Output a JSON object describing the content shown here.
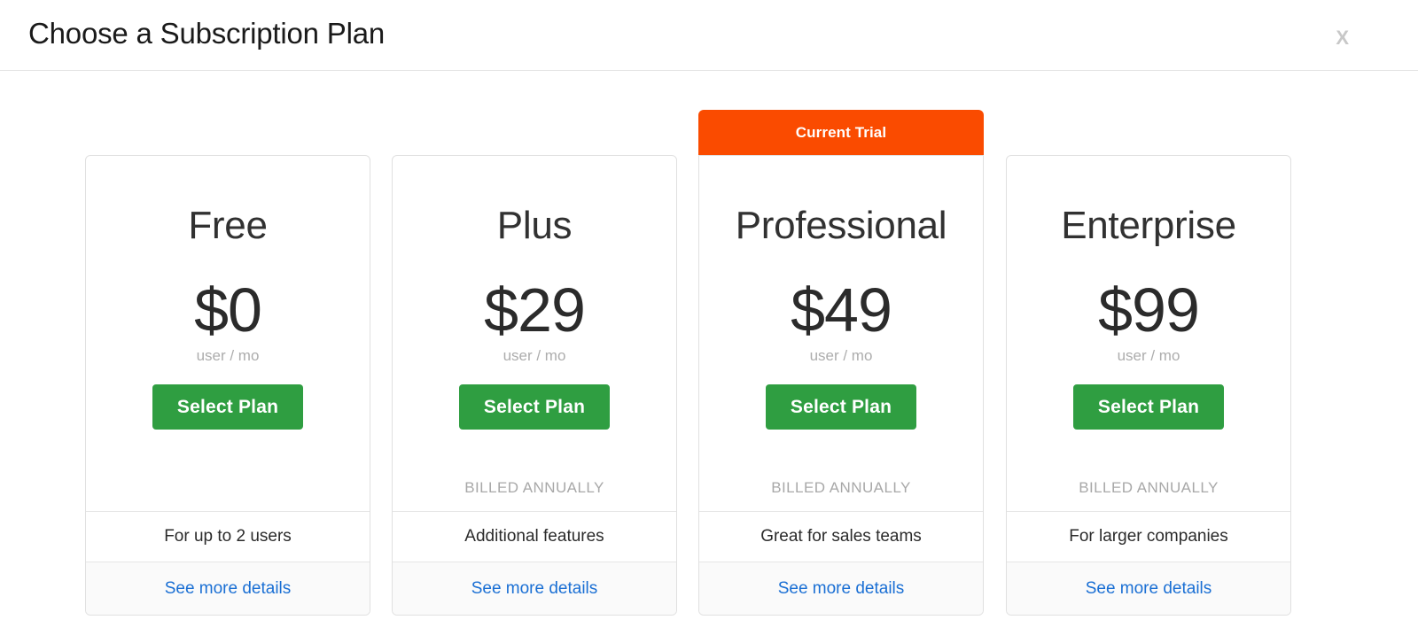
{
  "header": {
    "title": "Choose a Subscription Plan",
    "close_label": "X",
    "close_icon": "close-icon"
  },
  "colors": {
    "badge_orange": "#fa4b00",
    "button_green": "#2f9e41",
    "link_blue": "#1a6fd4",
    "muted_gray": "#a8a8a8",
    "card_border": "#e0e0e0",
    "footer_background": "#fafafa"
  },
  "plans": [
    {
      "name": "Free",
      "price": "$0",
      "period": "user / mo",
      "cta_label": "Select Plan",
      "billing_note": "",
      "detail": "For up to 2 users",
      "details_link_label": "See more details",
      "badge": "",
      "featured": false
    },
    {
      "name": "Plus",
      "price": "$29",
      "period": "user / mo",
      "cta_label": "Select Plan",
      "billing_note": "BILLED ANNUALLY",
      "detail": "Additional features",
      "details_link_label": "See more details",
      "badge": "",
      "featured": false
    },
    {
      "name": "Professional",
      "price": "$49",
      "period": "user / mo",
      "cta_label": "Select Plan",
      "billing_note": "BILLED ANNUALLY",
      "detail": "Great for sales teams",
      "details_link_label": "See more details",
      "badge": "Current Trial",
      "featured": true
    },
    {
      "name": "Enterprise",
      "price": "$99",
      "period": "user / mo",
      "cta_label": "Select Plan",
      "billing_note": "BILLED ANNUALLY",
      "detail": "For larger companies",
      "details_link_label": "See more details",
      "badge": "",
      "featured": false
    }
  ]
}
